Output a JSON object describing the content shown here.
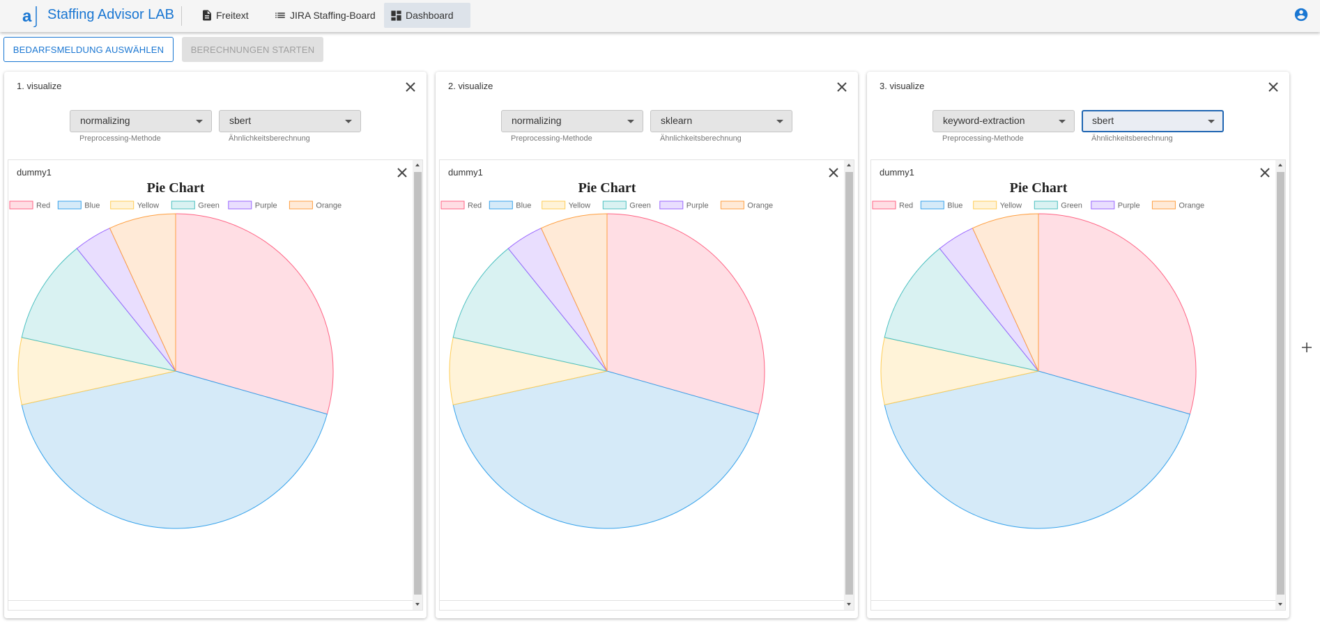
{
  "app": {
    "title": "Staffing Advisor LAB",
    "logo_letter": "a",
    "accent": "#1976d2"
  },
  "nav": {
    "items": [
      {
        "label": "Freitext",
        "icon": "document-icon"
      },
      {
        "label": "JIRA Staffing-Board",
        "icon": "list-icon"
      },
      {
        "label": "Dashboard",
        "icon": "dashboard-icon",
        "active": true
      }
    ],
    "user_icon": "account-circle-icon"
  },
  "actions": {
    "select_label": "BEDARFSMELDUNG AUSWÄHLEN",
    "start_label": "BERECHNUNGEN STARTEN",
    "start_disabled": true
  },
  "panels": [
    {
      "title": "1. visualize",
      "preprocessing": "normalizing",
      "preprocessing_hint": "Preprocessing-Methode",
      "similarity": "sbert",
      "similarity_hint": "Ähnlichkeitsberechnung",
      "card_title": "dummy1"
    },
    {
      "title": "2. visualize",
      "preprocessing": "normalizing",
      "preprocessing_hint": "Preprocessing-Methode",
      "similarity": "sklearn",
      "similarity_hint": "Ähnlichkeitsberechnung",
      "card_title": "dummy1"
    },
    {
      "title": "3. visualize",
      "preprocessing": "keyword-extraction",
      "preprocessing_hint": "Preprocessing-Methode",
      "similarity": "sbert",
      "similarity_hint": "Ähnlichkeitsberechnung",
      "card_title": "dummy1",
      "similarity_focused": true
    }
  ],
  "chart_data": {
    "type": "pie",
    "title": "Pie Chart",
    "legend_position": "top",
    "categories": [
      "Red",
      "Blue",
      "Yellow",
      "Green",
      "Purple",
      "Orange"
    ],
    "values": [
      30,
      43,
      7,
      11,
      4,
      7
    ],
    "fill_colors": [
      "#ffdee4",
      "#d5eaf8",
      "#fff3d8",
      "#d9f2f2",
      "#e9defe",
      "#ffead7"
    ],
    "stroke_colors": [
      "#ff6384",
      "#36a2eb",
      "#ffcd56",
      "#4bc0c0",
      "#9966ff",
      "#ff9f40"
    ]
  },
  "add_icon": "plus-icon"
}
